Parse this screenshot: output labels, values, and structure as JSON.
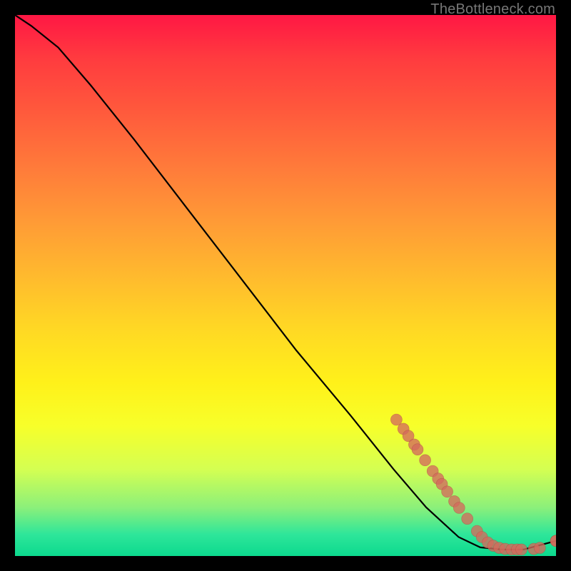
{
  "watermark": "TheBottleneck.com",
  "colors": {
    "page_bg": "#000000",
    "marker_fill": "#d46a5c",
    "marker_stroke": "#b24f43",
    "curve_stroke": "#000000"
  },
  "chart_data": {
    "type": "line",
    "title": "",
    "xlabel": "",
    "ylabel": "",
    "xlim": [
      0,
      100
    ],
    "ylim": [
      0,
      100
    ],
    "grid": false,
    "legend": false,
    "curve": [
      {
        "x": 0,
        "y": 100
      },
      {
        "x": 3,
        "y": 98
      },
      {
        "x": 8,
        "y": 94
      },
      {
        "x": 14,
        "y": 87
      },
      {
        "x": 22,
        "y": 77
      },
      {
        "x": 32,
        "y": 64
      },
      {
        "x": 42,
        "y": 51
      },
      {
        "x": 52,
        "y": 38
      },
      {
        "x": 62,
        "y": 26
      },
      {
        "x": 70,
        "y": 16
      },
      {
        "x": 76,
        "y": 9
      },
      {
        "x": 82,
        "y": 3.5
      },
      {
        "x": 86,
        "y": 1.6
      },
      {
        "x": 90,
        "y": 1.2
      },
      {
        "x": 94,
        "y": 1.2
      },
      {
        "x": 100,
        "y": 2.8
      }
    ],
    "markers": [
      {
        "x": 70.5,
        "y": 25.2
      },
      {
        "x": 71.8,
        "y": 23.5
      },
      {
        "x": 72.7,
        "y": 22.2
      },
      {
        "x": 73.8,
        "y": 20.6
      },
      {
        "x": 74.4,
        "y": 19.7
      },
      {
        "x": 75.8,
        "y": 17.7
      },
      {
        "x": 77.2,
        "y": 15.7
      },
      {
        "x": 78.2,
        "y": 14.3
      },
      {
        "x": 78.9,
        "y": 13.3
      },
      {
        "x": 79.9,
        "y": 11.9
      },
      {
        "x": 81.2,
        "y": 10.1
      },
      {
        "x": 82.1,
        "y": 8.9
      },
      {
        "x": 83.6,
        "y": 6.9
      },
      {
        "x": 85.4,
        "y": 4.6
      },
      {
        "x": 86.3,
        "y": 3.5
      },
      {
        "x": 87.4,
        "y": 2.5
      },
      {
        "x": 88.4,
        "y": 1.9
      },
      {
        "x": 89.5,
        "y": 1.5
      },
      {
        "x": 90.6,
        "y": 1.3
      },
      {
        "x": 91.8,
        "y": 1.2
      },
      {
        "x": 92.8,
        "y": 1.2
      },
      {
        "x": 93.6,
        "y": 1.2
      },
      {
        "x": 95.9,
        "y": 1.3
      },
      {
        "x": 97.0,
        "y": 1.5
      }
    ],
    "end_marker": {
      "x": 100,
      "y": 2.8
    }
  }
}
